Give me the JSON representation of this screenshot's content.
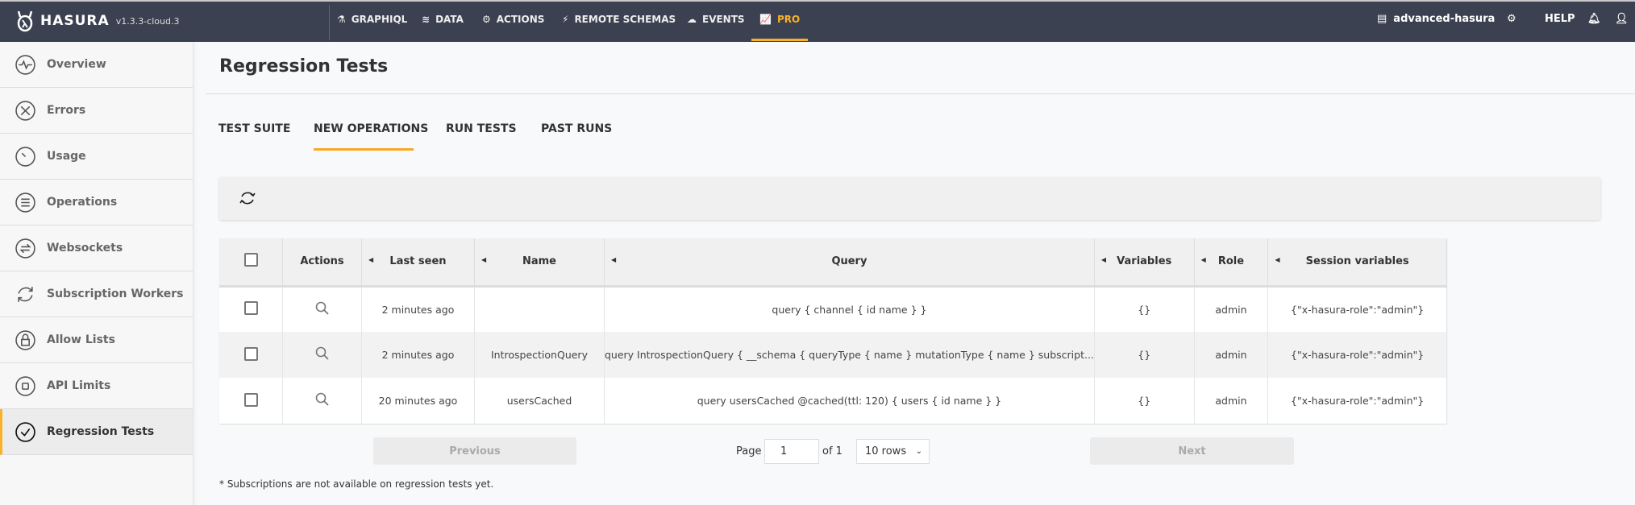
{
  "topnav": {
    "brand": "HASURA",
    "version": "v1.3.3-cloud.3",
    "items": [
      {
        "label": "GRAPHIQL",
        "icon": "flask-icon"
      },
      {
        "label": "DATA",
        "icon": "database-icon"
      },
      {
        "label": "ACTIONS",
        "icon": "cogs-icon"
      },
      {
        "label": "REMOTE SCHEMAS",
        "icon": "plug-icon"
      },
      {
        "label": "EVENTS",
        "icon": "cloud-icon"
      },
      {
        "label": "PRO",
        "icon": "chart-line-icon",
        "active": true
      }
    ],
    "project": "advanced-hasura",
    "help": "HELP",
    "accent": "#f9b128"
  },
  "sidebar": {
    "items": [
      {
        "label": "Overview"
      },
      {
        "label": "Errors"
      },
      {
        "label": "Usage"
      },
      {
        "label": "Operations"
      },
      {
        "label": "Websockets"
      },
      {
        "label": "Subscription Workers"
      },
      {
        "label": "Allow Lists"
      },
      {
        "label": "API Limits"
      },
      {
        "label": "Regression Tests",
        "active": true
      }
    ]
  },
  "page": {
    "title": "Regression Tests"
  },
  "tabs": [
    {
      "label": "TEST SUITE"
    },
    {
      "label": "NEW OPERATIONS",
      "active": true
    },
    {
      "label": "RUN TESTS"
    },
    {
      "label": "PAST RUNS"
    }
  ],
  "table": {
    "headers": [
      "Actions",
      "Last seen",
      "Name",
      "Query",
      "Variables",
      "Role",
      "Session variables"
    ],
    "rows": [
      {
        "last_seen": "2 minutes ago",
        "name": "",
        "query": "query { channel { id name } }",
        "variables": "{}",
        "role": "admin",
        "session": "{\"x-hasura-role\":\"admin\"}"
      },
      {
        "last_seen": "2 minutes ago",
        "name": "IntrospectionQuery",
        "query": "query IntrospectionQuery { __schema { queryType { name } mutationType { name } subscript...",
        "variables": "{}",
        "role": "admin",
        "session": "{\"x-hasura-role\":\"admin\"}"
      },
      {
        "last_seen": "20 minutes ago",
        "name": "usersCached",
        "query": "query usersCached @cached(ttl: 120) { users { id name } }",
        "variables": "{}",
        "role": "admin",
        "session": "{\"x-hasura-role\":\"admin\"}"
      }
    ]
  },
  "pagination": {
    "previous": "Previous",
    "next": "Next",
    "page_label": "Page",
    "page": "1",
    "of": "of 1",
    "rows": "10 rows"
  },
  "footnote": "* Subscriptions are not available on regression tests yet."
}
